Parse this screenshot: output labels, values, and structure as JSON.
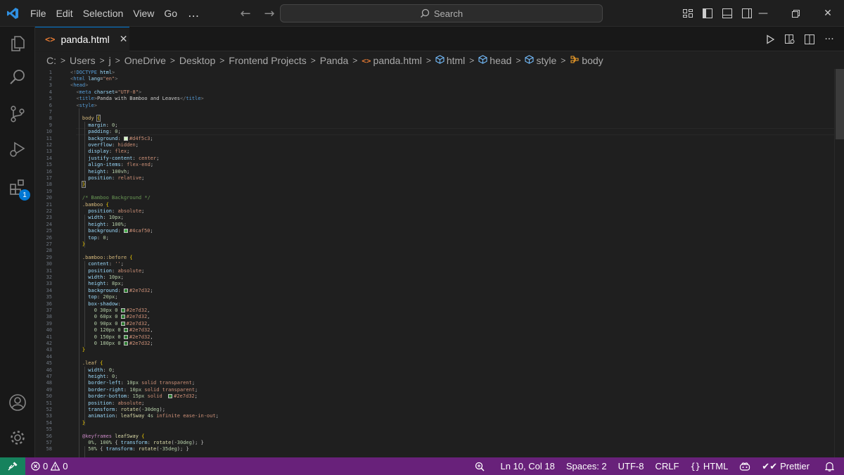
{
  "titlebar": {
    "menu": [
      "File",
      "Edit",
      "Selection",
      "View",
      "Go"
    ],
    "more": "…",
    "search_placeholder": "Search"
  },
  "activity_bar": {
    "icons": [
      "files-icon",
      "search-icon",
      "source-control-icon",
      "run-debug-icon",
      "extensions-icon"
    ],
    "extensions_badge": "1",
    "bottom_icons": [
      "account-icon",
      "settings-gear-icon"
    ]
  },
  "tab": {
    "label": "panda.html",
    "close": "✕",
    "icon_text": "<>"
  },
  "breadcrumbs": [
    "C:",
    "Users",
    "j",
    "OneDrive",
    "Desktop",
    "Frontend Projects",
    "Panda",
    "panda.html",
    "html",
    "head",
    "style",
    "body"
  ],
  "editor": {
    "line_numbers": [
      "1",
      "2",
      "3",
      "4",
      "5",
      "6",
      "7",
      "8",
      "9",
      "10",
      "11",
      "12",
      "13",
      "14",
      "15",
      "16",
      "17",
      "18",
      "19",
      "20",
      "21",
      "22",
      "23",
      "24",
      "25",
      "26",
      "27",
      "28",
      "29",
      "30",
      "31",
      "32",
      "33",
      "34",
      "35",
      "36",
      "37",
      "38",
      "39",
      "40",
      "41",
      "42",
      "43",
      "44",
      "45",
      "46",
      "47",
      "48",
      "49",
      "50",
      "51",
      "52",
      "53",
      "54",
      "55",
      "56",
      "57",
      "58"
    ],
    "lines": [
      [
        [
          "t-punc",
          "<!"
        ],
        [
          "t-tag",
          "DOCTYPE"
        ],
        [
          "t-text",
          " "
        ],
        [
          "t-attr",
          "html"
        ],
        [
          "t-punc",
          ">"
        ]
      ],
      [
        [
          "t-punc",
          "<"
        ],
        [
          "t-tag",
          "html"
        ],
        [
          "t-text",
          " "
        ],
        [
          "t-attr",
          "lang"
        ],
        [
          "t-text",
          "="
        ],
        [
          "t-str",
          "\"en\""
        ],
        [
          "t-punc",
          ">"
        ]
      ],
      [
        [
          "t-punc",
          "<"
        ],
        [
          "t-tag",
          "head"
        ],
        [
          "t-punc",
          ">"
        ]
      ],
      [
        [
          "t-text",
          "  "
        ],
        [
          "t-punc",
          "<"
        ],
        [
          "t-tag",
          "meta"
        ],
        [
          "t-text",
          " "
        ],
        [
          "t-attr",
          "charset"
        ],
        [
          "t-text",
          "="
        ],
        [
          "t-str",
          "\"UTF-8\""
        ],
        [
          "t-punc",
          ">"
        ]
      ],
      [
        [
          "t-text",
          "  "
        ],
        [
          "t-punc",
          "<"
        ],
        [
          "t-tag",
          "title"
        ],
        [
          "t-punc",
          ">"
        ],
        [
          "t-text",
          "Panda with Bamboo and Leaves"
        ],
        [
          "t-punc",
          "</"
        ],
        [
          "t-tag",
          "title"
        ],
        [
          "t-punc",
          ">"
        ]
      ],
      [
        [
          "t-text",
          "  "
        ],
        [
          "t-punc",
          "<"
        ],
        [
          "t-tag",
          "style"
        ],
        [
          "t-punc",
          ">"
        ]
      ],
      [],
      [
        [
          "t-text",
          "    "
        ],
        [
          "t-sel",
          "body"
        ],
        [
          "t-text",
          " "
        ],
        [
          "t-brace-hl",
          "{"
        ]
      ],
      [
        [
          "t-text",
          "      "
        ],
        [
          "t-prop",
          "margin"
        ],
        [
          "t-text",
          ": "
        ],
        [
          "t-num",
          "0"
        ],
        [
          "t-text",
          ";"
        ]
      ],
      [
        [
          "t-text",
          "      "
        ],
        [
          "t-prop",
          "padding"
        ],
        [
          "t-text",
          ": "
        ],
        [
          "t-num",
          "0"
        ],
        [
          "t-text",
          ";"
        ]
      ],
      [
        [
          "t-text",
          "      "
        ],
        [
          "t-prop",
          "background"
        ],
        [
          "t-text",
          ": "
        ],
        [
          "sw",
          "#d4f5c3"
        ],
        [
          "t-val",
          "#d4f5c3"
        ],
        [
          "t-text",
          ";"
        ]
      ],
      [
        [
          "t-text",
          "      "
        ],
        [
          "t-prop",
          "overflow"
        ],
        [
          "t-text",
          ": "
        ],
        [
          "t-val",
          "hidden"
        ],
        [
          "t-text",
          ";"
        ]
      ],
      [
        [
          "t-text",
          "      "
        ],
        [
          "t-prop",
          "display"
        ],
        [
          "t-text",
          ": "
        ],
        [
          "t-val",
          "flex"
        ],
        [
          "t-text",
          ";"
        ]
      ],
      [
        [
          "t-text",
          "      "
        ],
        [
          "t-prop",
          "justify-content"
        ],
        [
          "t-text",
          ": "
        ],
        [
          "t-val",
          "center"
        ],
        [
          "t-text",
          ";"
        ]
      ],
      [
        [
          "t-text",
          "      "
        ],
        [
          "t-prop",
          "align-items"
        ],
        [
          "t-text",
          ": "
        ],
        [
          "t-val",
          "flex-end"
        ],
        [
          "t-text",
          ";"
        ]
      ],
      [
        [
          "t-text",
          "      "
        ],
        [
          "t-prop",
          "height"
        ],
        [
          "t-text",
          ": "
        ],
        [
          "t-num",
          "100vh"
        ],
        [
          "t-text",
          ";"
        ]
      ],
      [
        [
          "t-text",
          "      "
        ],
        [
          "t-prop",
          "position"
        ],
        [
          "t-text",
          ": "
        ],
        [
          "t-val",
          "relative"
        ],
        [
          "t-text",
          ";"
        ]
      ],
      [
        [
          "t-text",
          "    "
        ],
        [
          "t-brace-hl",
          "}"
        ]
      ],
      [],
      [
        [
          "t-text",
          "    "
        ],
        [
          "t-com",
          "/* Bamboo Background */"
        ]
      ],
      [
        [
          "t-text",
          "    "
        ],
        [
          "t-sel",
          ".bamboo"
        ],
        [
          "t-text",
          " "
        ],
        [
          "t-brace",
          "{"
        ]
      ],
      [
        [
          "t-text",
          "      "
        ],
        [
          "t-prop",
          "position"
        ],
        [
          "t-text",
          ": "
        ],
        [
          "t-val",
          "absolute"
        ],
        [
          "t-text",
          ";"
        ]
      ],
      [
        [
          "t-text",
          "      "
        ],
        [
          "t-prop",
          "width"
        ],
        [
          "t-text",
          ": "
        ],
        [
          "t-num",
          "10px"
        ],
        [
          "t-text",
          ";"
        ]
      ],
      [
        [
          "t-text",
          "      "
        ],
        [
          "t-prop",
          "height"
        ],
        [
          "t-text",
          ": "
        ],
        [
          "t-num",
          "100%"
        ],
        [
          "t-text",
          ";"
        ]
      ],
      [
        [
          "t-text",
          "      "
        ],
        [
          "t-prop",
          "background"
        ],
        [
          "t-text",
          ": "
        ],
        [
          "sw",
          "#4caf50"
        ],
        [
          "t-val",
          "#4caf50"
        ],
        [
          "t-text",
          ";"
        ]
      ],
      [
        [
          "t-text",
          "      "
        ],
        [
          "t-prop",
          "top"
        ],
        [
          "t-text",
          ": "
        ],
        [
          "t-num",
          "0"
        ],
        [
          "t-text",
          ";"
        ]
      ],
      [
        [
          "t-text",
          "    "
        ],
        [
          "t-brace",
          "}"
        ]
      ],
      [],
      [
        [
          "t-text",
          "    "
        ],
        [
          "t-sel",
          ".bamboo::before"
        ],
        [
          "t-text",
          " "
        ],
        [
          "t-brace",
          "{"
        ]
      ],
      [
        [
          "t-text",
          "      "
        ],
        [
          "t-prop",
          "content"
        ],
        [
          "t-text",
          ": "
        ],
        [
          "t-str",
          "''"
        ],
        [
          "t-text",
          ";"
        ]
      ],
      [
        [
          "t-text",
          "      "
        ],
        [
          "t-prop",
          "position"
        ],
        [
          "t-text",
          ": "
        ],
        [
          "t-val",
          "absolute"
        ],
        [
          "t-text",
          ";"
        ]
      ],
      [
        [
          "t-text",
          "      "
        ],
        [
          "t-prop",
          "width"
        ],
        [
          "t-text",
          ": "
        ],
        [
          "t-num",
          "10px"
        ],
        [
          "t-text",
          ";"
        ]
      ],
      [
        [
          "t-text",
          "      "
        ],
        [
          "t-prop",
          "height"
        ],
        [
          "t-text",
          ": "
        ],
        [
          "t-num",
          "8px"
        ],
        [
          "t-text",
          ";"
        ]
      ],
      [
        [
          "t-text",
          "      "
        ],
        [
          "t-prop",
          "background"
        ],
        [
          "t-text",
          ": "
        ],
        [
          "sw",
          "#2e7d32"
        ],
        [
          "t-val",
          "#2e7d32"
        ],
        [
          "t-text",
          ";"
        ]
      ],
      [
        [
          "t-text",
          "      "
        ],
        [
          "t-prop",
          "top"
        ],
        [
          "t-text",
          ": "
        ],
        [
          "t-num",
          "20px"
        ],
        [
          "t-text",
          ";"
        ]
      ],
      [
        [
          "t-text",
          "      "
        ],
        [
          "t-prop",
          "box-shadow"
        ],
        [
          "t-text",
          ":"
        ]
      ],
      [
        [
          "t-text",
          "        "
        ],
        [
          "t-num",
          "0 30px 0"
        ],
        [
          "t-text",
          " "
        ],
        [
          "sw",
          "#2e7d32"
        ],
        [
          "t-val",
          "#2e7d32"
        ],
        [
          "t-text",
          ","
        ]
      ],
      [
        [
          "t-text",
          "        "
        ],
        [
          "t-num",
          "0 60px 0"
        ],
        [
          "t-text",
          " "
        ],
        [
          "sw",
          "#2e7d32"
        ],
        [
          "t-val",
          "#2e7d32"
        ],
        [
          "t-text",
          ","
        ]
      ],
      [
        [
          "t-text",
          "        "
        ],
        [
          "t-num",
          "0 90px 0"
        ],
        [
          "t-text",
          " "
        ],
        [
          "sw",
          "#2e7d32"
        ],
        [
          "t-val",
          "#2e7d32"
        ],
        [
          "t-text",
          ","
        ]
      ],
      [
        [
          "t-text",
          "        "
        ],
        [
          "t-num",
          "0 120px 0"
        ],
        [
          "t-text",
          " "
        ],
        [
          "sw",
          "#2e7d32"
        ],
        [
          "t-val",
          "#2e7d32"
        ],
        [
          "t-text",
          ","
        ]
      ],
      [
        [
          "t-text",
          "        "
        ],
        [
          "t-num",
          "0 150px 0"
        ],
        [
          "t-text",
          " "
        ],
        [
          "sw",
          "#2e7d32"
        ],
        [
          "t-val",
          "#2e7d32"
        ],
        [
          "t-text",
          ","
        ]
      ],
      [
        [
          "t-text",
          "        "
        ],
        [
          "t-num",
          "0 180px 0"
        ],
        [
          "t-text",
          " "
        ],
        [
          "sw",
          "#2e7d32"
        ],
        [
          "t-val",
          "#2e7d32"
        ],
        [
          "t-text",
          ";"
        ]
      ],
      [
        [
          "t-text",
          "    "
        ],
        [
          "t-brace",
          "}"
        ]
      ],
      [],
      [
        [
          "t-text",
          "    "
        ],
        [
          "t-sel",
          ".leaf"
        ],
        [
          "t-text",
          " "
        ],
        [
          "t-brace",
          "{"
        ]
      ],
      [
        [
          "t-text",
          "      "
        ],
        [
          "t-prop",
          "width"
        ],
        [
          "t-text",
          ": "
        ],
        [
          "t-num",
          "0"
        ],
        [
          "t-text",
          ";"
        ]
      ],
      [
        [
          "t-text",
          "      "
        ],
        [
          "t-prop",
          "height"
        ],
        [
          "t-text",
          ": "
        ],
        [
          "t-num",
          "0"
        ],
        [
          "t-text",
          ";"
        ]
      ],
      [
        [
          "t-text",
          "      "
        ],
        [
          "t-prop",
          "border-left"
        ],
        [
          "t-text",
          ": "
        ],
        [
          "t-num",
          "10px"
        ],
        [
          "t-text",
          " "
        ],
        [
          "t-val",
          "solid transparent"
        ],
        [
          "t-text",
          ";"
        ]
      ],
      [
        [
          "t-text",
          "      "
        ],
        [
          "t-prop",
          "border-right"
        ],
        [
          "t-text",
          ": "
        ],
        [
          "t-num",
          "10px"
        ],
        [
          "t-text",
          " "
        ],
        [
          "t-val",
          "solid transparent"
        ],
        [
          "t-text",
          ";"
        ]
      ],
      [
        [
          "t-text",
          "      "
        ],
        [
          "t-prop",
          "border-bottom"
        ],
        [
          "t-text",
          ": "
        ],
        [
          "t-num",
          "15px"
        ],
        [
          "t-text",
          " "
        ],
        [
          "t-val",
          "solid"
        ],
        [
          "t-text",
          "  "
        ],
        [
          "sw",
          "#2e7d32"
        ],
        [
          "t-val",
          "#2e7d32"
        ],
        [
          "t-text",
          ";"
        ]
      ],
      [
        [
          "t-text",
          "      "
        ],
        [
          "t-prop",
          "position"
        ],
        [
          "t-text",
          ": "
        ],
        [
          "t-val",
          "absolute"
        ],
        [
          "t-text",
          ";"
        ]
      ],
      [
        [
          "t-text",
          "      "
        ],
        [
          "t-prop",
          "transform"
        ],
        [
          "t-text",
          ": "
        ],
        [
          "t-fn",
          "rotate"
        ],
        [
          "t-text",
          "("
        ],
        [
          "t-num",
          "-30deg"
        ],
        [
          "t-text",
          ");"
        ]
      ],
      [
        [
          "t-text",
          "      "
        ],
        [
          "t-prop",
          "animation"
        ],
        [
          "t-text",
          ": "
        ],
        [
          "t-fn",
          "leafSway"
        ],
        [
          "t-text",
          " "
        ],
        [
          "t-num",
          "4s"
        ],
        [
          "t-text",
          " "
        ],
        [
          "t-val",
          "infinite ease-in-out"
        ],
        [
          "t-text",
          ";"
        ]
      ],
      [
        [
          "t-text",
          "    "
        ],
        [
          "t-brace",
          "}"
        ]
      ],
      [],
      [
        [
          "t-text",
          "    "
        ],
        [
          "t-key",
          "@keyframes"
        ],
        [
          "t-text",
          " "
        ],
        [
          "t-fn",
          "leafSway"
        ],
        [
          "t-text",
          " "
        ],
        [
          "t-brace",
          "{"
        ]
      ],
      [
        [
          "t-text",
          "      "
        ],
        [
          "t-num",
          "0%, 100%"
        ],
        [
          "t-text",
          " { "
        ],
        [
          "t-prop",
          "transform"
        ],
        [
          "t-text",
          ": "
        ],
        [
          "t-fn",
          "rotate"
        ],
        [
          "t-text",
          "("
        ],
        [
          "t-num",
          "-30deg"
        ],
        [
          "t-text",
          "); }"
        ]
      ],
      [
        [
          "t-text",
          "      "
        ],
        [
          "t-num",
          "50%"
        ],
        [
          "t-text",
          " { "
        ],
        [
          "t-prop",
          "transform"
        ],
        [
          "t-text",
          ": "
        ],
        [
          "t-fn",
          "rotate"
        ],
        [
          "t-text",
          "("
        ],
        [
          "t-num",
          "-35deg"
        ],
        [
          "t-text",
          "); }"
        ]
      ]
    ]
  },
  "statusbar": {
    "errors": "0",
    "warnings": "0",
    "position": "Ln 10, Col 18",
    "spaces": "Spaces: 2",
    "encoding": "UTF-8",
    "eol": "CRLF",
    "language": "HTML",
    "formatter": "Prettier"
  },
  "colors": {
    "accent": "#0078d4",
    "statusbar": "#68217a",
    "remote": "#16825d"
  }
}
